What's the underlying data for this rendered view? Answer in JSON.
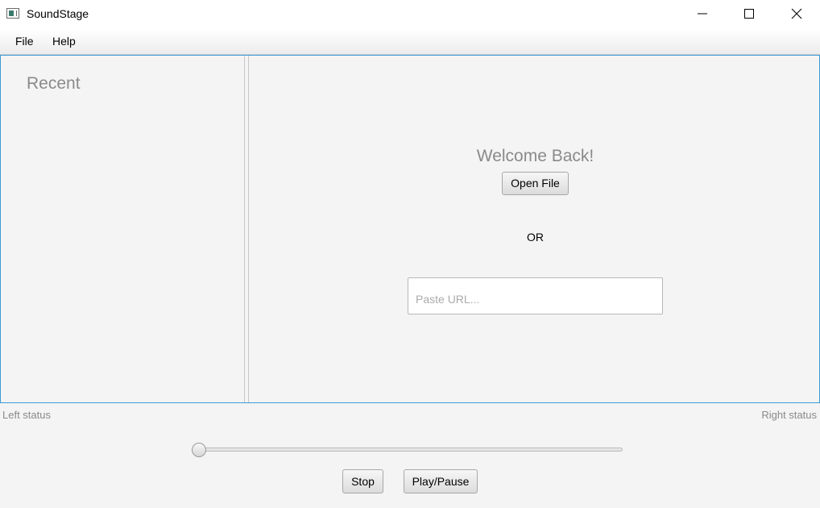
{
  "window": {
    "title": "SoundStage",
    "icon": "app-icon"
  },
  "menu": {
    "items": [
      "File",
      "Help"
    ]
  },
  "sidebar": {
    "title": "Recent"
  },
  "main": {
    "welcome": "Welcome Back!",
    "open_file_label": "Open File",
    "or_label": "OR",
    "url_placeholder": "Paste URL...",
    "url_value": ""
  },
  "status": {
    "left": "Left status",
    "right": "Right status"
  },
  "player": {
    "position": 0,
    "stop_label": "Stop",
    "play_pause_label": "Play/Pause"
  },
  "colors": {
    "accent": "#3c9ad6",
    "muted_text": "#8a8a8a",
    "background": "#f4f4f4"
  }
}
